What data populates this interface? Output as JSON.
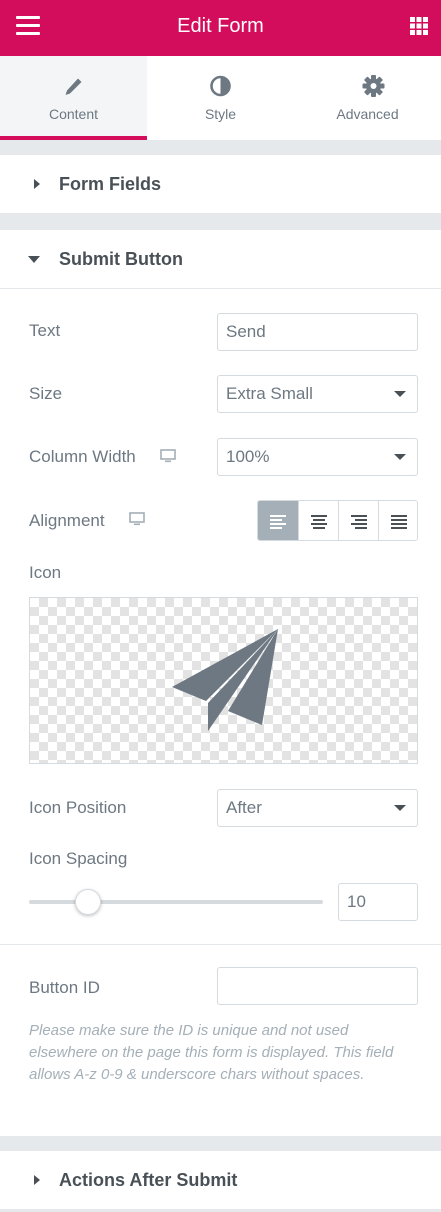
{
  "header": {
    "title": "Edit Form",
    "menu_icon": "hamburger-icon",
    "grid_icon": "apps-grid-icon"
  },
  "tabs": [
    {
      "label": "Content",
      "icon": "pencil-icon",
      "active": true
    },
    {
      "label": "Style",
      "icon": "half-circle-icon",
      "active": false
    },
    {
      "label": "Advanced",
      "icon": "gear-icon",
      "active": false
    }
  ],
  "sections": {
    "form_fields": {
      "title": "Form Fields",
      "expanded": false
    },
    "submit_button": {
      "title": "Submit Button",
      "expanded": true
    },
    "actions_after_submit": {
      "title": "Actions After Submit",
      "expanded": false
    }
  },
  "submit_button": {
    "text": {
      "label": "Text",
      "value": "Send"
    },
    "size": {
      "label": "Size",
      "value": "Extra Small"
    },
    "column_width": {
      "label": "Column Width",
      "value": "100%"
    },
    "alignment": {
      "label": "Alignment",
      "options": [
        "left",
        "center",
        "right",
        "justify"
      ],
      "selected": "left"
    },
    "icon": {
      "label": "Icon",
      "value": "paper-plane-icon"
    },
    "icon_position": {
      "label": "Icon Position",
      "value": "After"
    },
    "icon_spacing": {
      "label": "Icon Spacing",
      "value": "10",
      "slider_fraction": 0.2
    },
    "button_id": {
      "label": "Button ID",
      "value": ""
    },
    "help_text": "Please make sure the ID is unique and not used elsewhere on the page this form is displayed. This field allows A-z 0-9 & underscore chars without spaces."
  },
  "colors": {
    "brand": "#d30c5c",
    "text": "#6d7882",
    "heading": "#495157",
    "border": "#d5dadf",
    "muted": "#a4afb7"
  }
}
